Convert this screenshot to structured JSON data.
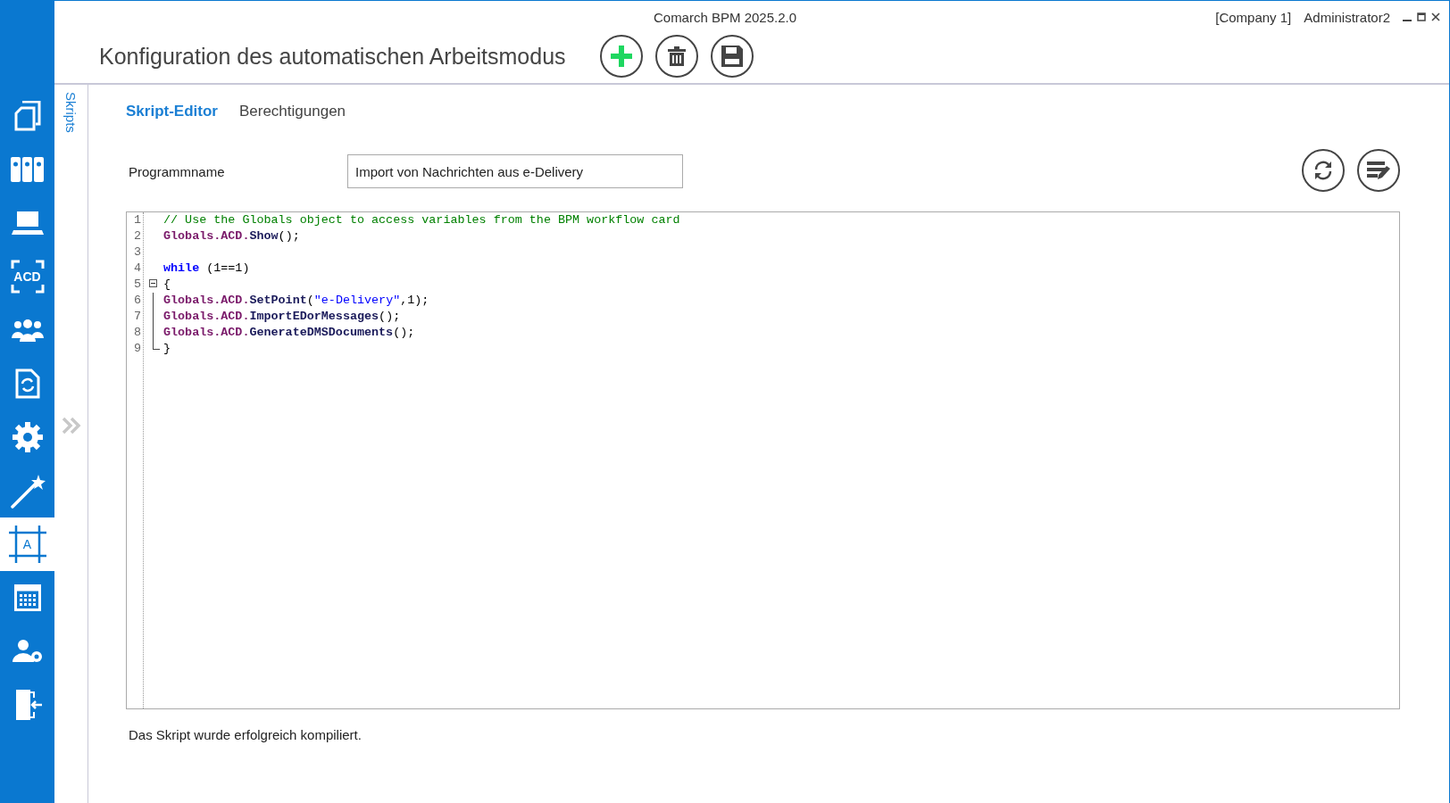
{
  "window": {
    "title": "Comarch BPM 2025.2.0",
    "company": "[Company 1]",
    "user": "Administrator2"
  },
  "sidebar": {
    "items": [
      {
        "kind": "copies",
        "selected": false
      },
      {
        "kind": "binders",
        "selected": false
      },
      {
        "kind": "laptop",
        "selected": false
      },
      {
        "kind": "scan",
        "label": "ACD",
        "selected": false
      },
      {
        "kind": "people",
        "selected": false
      },
      {
        "kind": "doc-sync",
        "selected": false
      },
      {
        "kind": "gear",
        "selected": false
      },
      {
        "kind": "wand",
        "selected": false
      },
      {
        "kind": "canvas",
        "label": "A",
        "selected": true
      },
      {
        "kind": "calendar",
        "selected": false
      },
      {
        "kind": "user-gear",
        "selected": false
      },
      {
        "kind": "exit",
        "selected": false
      }
    ]
  },
  "page": {
    "title": "Konfiguration des automatischen Arbeitsmodus",
    "actions": [
      {
        "kind": "add"
      },
      {
        "kind": "delete"
      },
      {
        "kind": "save"
      }
    ]
  },
  "side_panel": {
    "label": "Skripts"
  },
  "tabs": [
    {
      "label": "Skript-Editor",
      "selected": true
    },
    {
      "label": "Berechtigungen",
      "selected": false
    }
  ],
  "program_name": {
    "label": "Programmname",
    "value": "Import von Nachrichten aus e-Delivery"
  },
  "editor_actions": [
    {
      "kind": "refresh"
    },
    {
      "kind": "format"
    }
  ],
  "code": {
    "lines": [
      {
        "number": "1",
        "tokens": [
          {
            "text": "// Use the Globals object to access variables from the BPM workflow card",
            "kind": "comment"
          }
        ]
      },
      {
        "number": "2",
        "tokens": [
          {
            "text": "Globals.ACD.",
            "kind": "object"
          },
          {
            "text": "Show",
            "kind": "method"
          },
          {
            "text": "();",
            "kind": "plain"
          }
        ]
      },
      {
        "number": "3"
      },
      {
        "number": "4",
        "tokens": [
          {
            "text": "while",
            "kind": "keyword"
          },
          {
            "text": " (1==1)",
            "kind": "plain"
          }
        ]
      },
      {
        "number": "5",
        "kind": "fold-start",
        "tokens": [
          {
            "text": "{",
            "kind": "plain"
          }
        ]
      },
      {
        "number": "6",
        "kind": "fold-body",
        "tokens": [
          {
            "text": "Globals.ACD.",
            "kind": "object"
          },
          {
            "text": "SetPoint",
            "kind": "method"
          },
          {
            "text": "(",
            "kind": "plain"
          },
          {
            "text": "\"e-Delivery\"",
            "kind": "string"
          },
          {
            "text": ",1);",
            "kind": "plain"
          }
        ]
      },
      {
        "number": "7",
        "kind": "fold-body",
        "tokens": [
          {
            "text": "Globals.ACD.",
            "kind": "object"
          },
          {
            "text": "ImportEDorMessages",
            "kind": "method"
          },
          {
            "text": "();",
            "kind": "plain"
          }
        ]
      },
      {
        "number": "8",
        "kind": "fold-body",
        "tokens": [
          {
            "text": "Globals.ACD.",
            "kind": "object"
          },
          {
            "text": "GenerateDMSDocuments",
            "kind": "method"
          },
          {
            "text": "();",
            "kind": "plain"
          }
        ]
      },
      {
        "number": "9",
        "kind": "fold-end",
        "tokens": [
          {
            "text": "}",
            "kind": "plain"
          }
        ]
      }
    ]
  },
  "status": "Das Skript wurde erfolgreich kompiliert."
}
